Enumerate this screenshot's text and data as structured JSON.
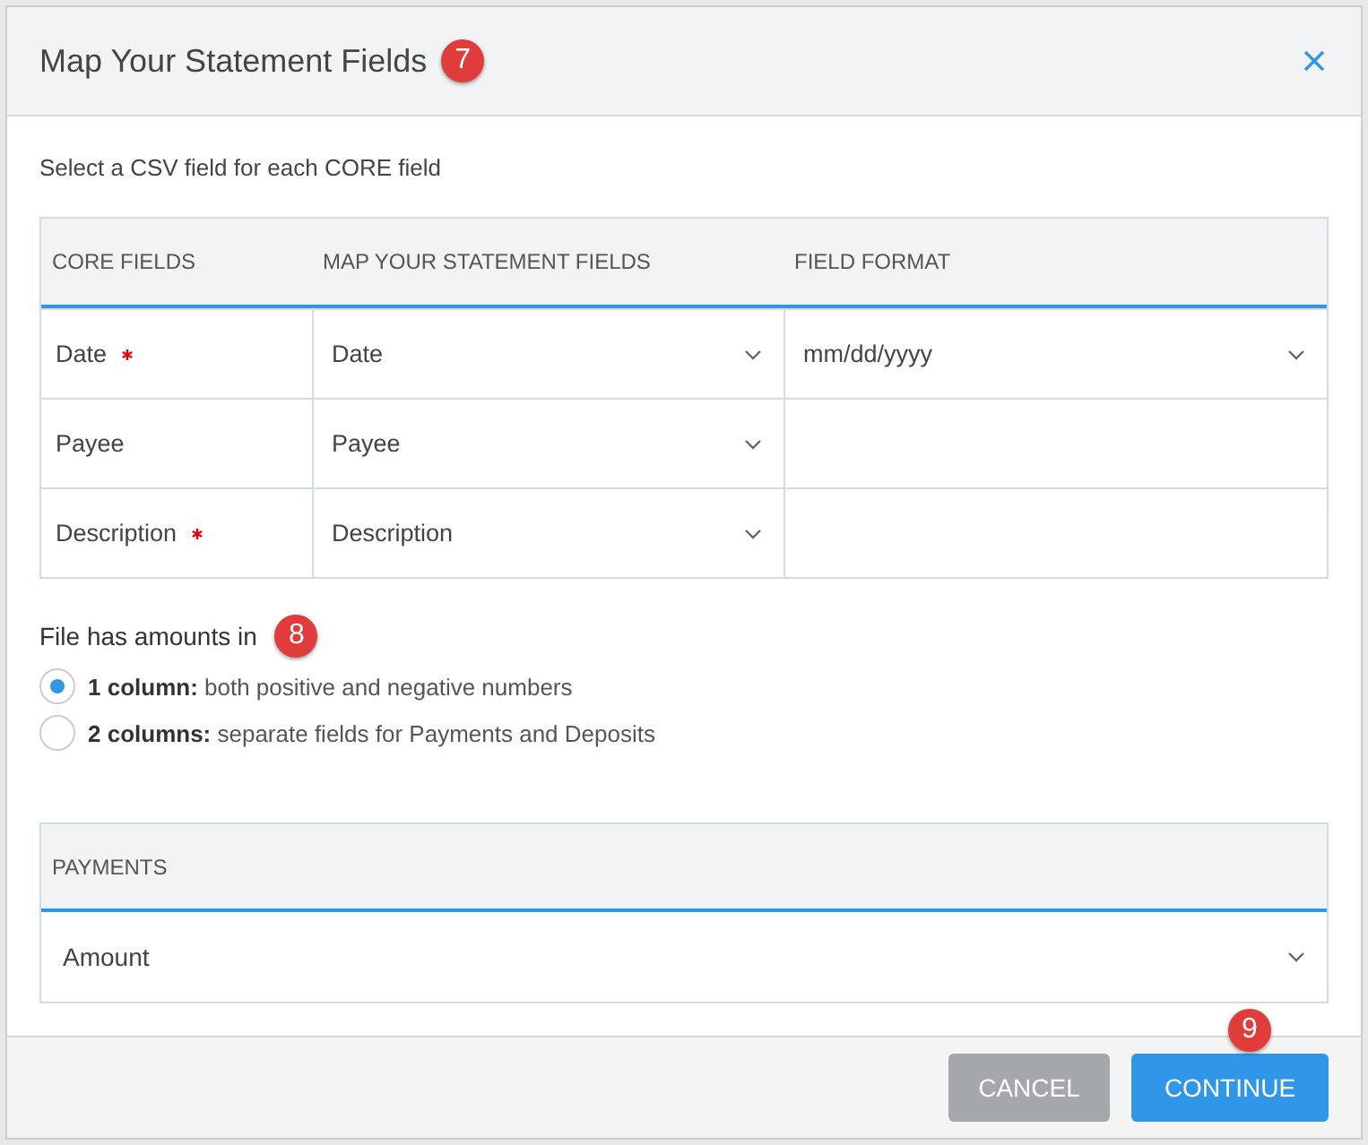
{
  "dialog": {
    "title": "Map Your Statement Fields",
    "title_badge": "7"
  },
  "instruction": "Select a CSV field for each CORE field",
  "table": {
    "columns": [
      "CORE FIELDS",
      "MAP YOUR STATEMENT FIELDS",
      "FIELD FORMAT"
    ],
    "rows": [
      {
        "core_field": "Date",
        "required": true,
        "mapping": "Date",
        "format": "mm/dd/yyyy"
      },
      {
        "core_field": "Payee",
        "required": false,
        "mapping": "Payee"
      },
      {
        "core_field": "Description",
        "required": true,
        "mapping": "Description"
      }
    ]
  },
  "amounts": {
    "label": "File has amounts in",
    "badge": "8",
    "options": [
      {
        "text": "**1 column:** both positive and negative numbers",
        "selected": true
      },
      {
        "text": "**2 columns:** separate fields for Payments and Deposits",
        "selected": false
      }
    ]
  },
  "payments": {
    "header": "PAYMENTS",
    "value": "Amount"
  },
  "footer": {
    "badge": "9",
    "buttons": [
      {
        "label": "CANCEL",
        "kind": "secondary"
      },
      {
        "label": "CONTINUE",
        "kind": "primary"
      }
    ]
  }
}
